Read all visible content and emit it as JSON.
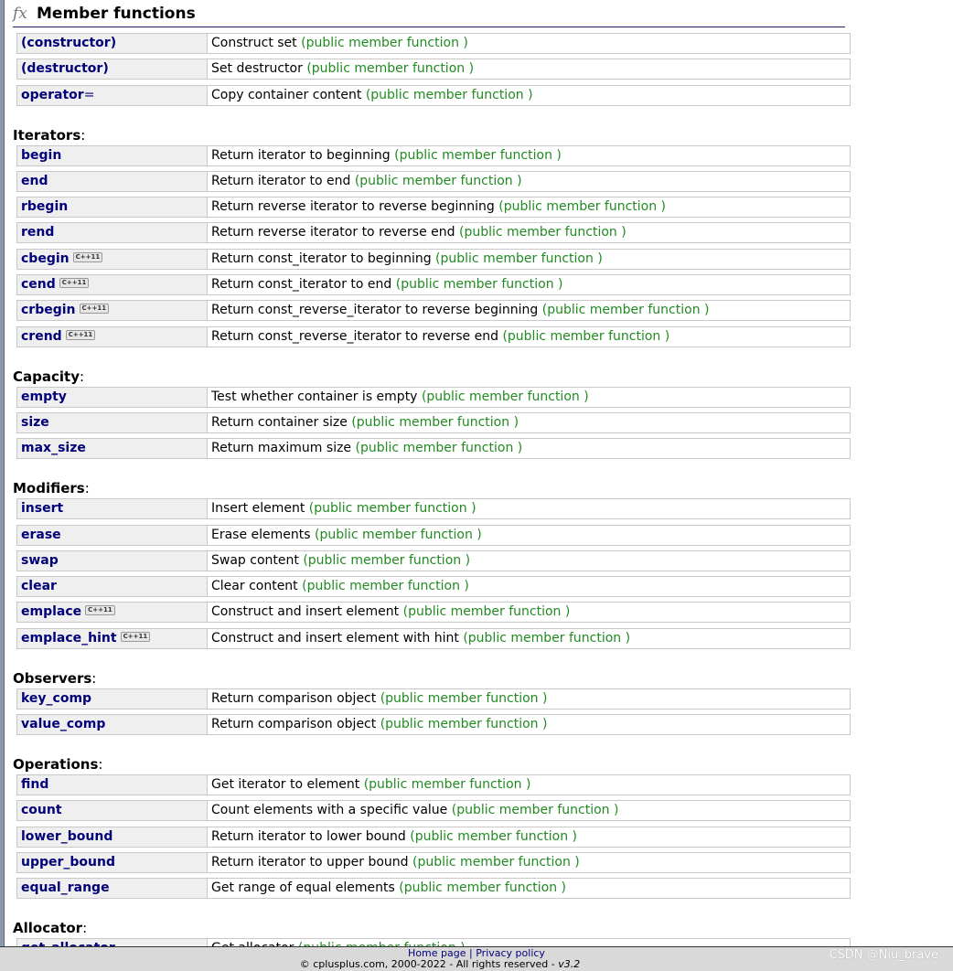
{
  "header": {
    "icon": "fx-icon",
    "icon_text": "fx",
    "title": "Member functions"
  },
  "kind_label": "(public member function )",
  "badge_label": "C++11",
  "groups": [
    {
      "title": "",
      "items": [
        {
          "name": "(constructor)",
          "desc": "Construct set"
        },
        {
          "name": "(destructor)",
          "desc": "Set destructor"
        },
        {
          "name": "operator",
          "suffix": "=",
          "desc": "Copy container content"
        }
      ]
    },
    {
      "title": "Iterators",
      "items": [
        {
          "name": "begin",
          "desc": "Return iterator to beginning"
        },
        {
          "name": "end",
          "desc": "Return iterator to end"
        },
        {
          "name": "rbegin",
          "desc": "Return reverse iterator to reverse beginning"
        },
        {
          "name": "rend",
          "desc": "Return reverse iterator to reverse end"
        },
        {
          "name": "cbegin",
          "cpp11": true,
          "desc": "Return const_iterator to beginning"
        },
        {
          "name": "cend",
          "cpp11": true,
          "desc": "Return const_iterator to end"
        },
        {
          "name": "crbegin",
          "cpp11": true,
          "desc": "Return const_reverse_iterator to reverse beginning"
        },
        {
          "name": "crend",
          "cpp11": true,
          "desc": "Return const_reverse_iterator to reverse end"
        }
      ]
    },
    {
      "title": "Capacity",
      "items": [
        {
          "name": "empty",
          "desc": "Test whether container is empty"
        },
        {
          "name": "size",
          "desc": "Return container size"
        },
        {
          "name": "max_size",
          "desc": "Return maximum size"
        }
      ]
    },
    {
      "title": "Modifiers",
      "items": [
        {
          "name": "insert",
          "desc": "Insert element"
        },
        {
          "name": "erase",
          "desc": "Erase elements"
        },
        {
          "name": "swap",
          "desc": "Swap content"
        },
        {
          "name": "clear",
          "desc": "Clear content"
        },
        {
          "name": "emplace",
          "cpp11": true,
          "desc": "Construct and insert element"
        },
        {
          "name": "emplace_hint",
          "cpp11": true,
          "desc": "Construct and insert element with hint"
        }
      ]
    },
    {
      "title": "Observers",
      "items": [
        {
          "name": "key_comp",
          "desc": "Return comparison object"
        },
        {
          "name": "value_comp",
          "desc": "Return comparison object"
        }
      ]
    },
    {
      "title": "Operations",
      "items": [
        {
          "name": "find",
          "desc": "Get iterator to element"
        },
        {
          "name": "count",
          "desc": "Count elements with a specific value"
        },
        {
          "name": "lower_bound",
          "desc": "Return iterator to lower bound"
        },
        {
          "name": "upper_bound",
          "desc": "Return iterator to upper bound"
        },
        {
          "name": "equal_range",
          "desc": "Get range of equal elements"
        }
      ]
    },
    {
      "title": "Allocator",
      "items": [
        {
          "name": "get_allocator",
          "desc": "Get allocator"
        }
      ]
    }
  ],
  "footer": {
    "home": "Home page",
    "sep": "|",
    "privacy": "Privacy policy",
    "copyright": "© cplusplus.com, 2000-2022 - All rights reserved - ",
    "version": "v3.2"
  },
  "watermark": "CSDN @Niu_brave",
  "colors": {
    "name": "#00007a",
    "kind": "#218a21",
    "name_bg": "#efefef",
    "border": "#c8c8c8"
  }
}
